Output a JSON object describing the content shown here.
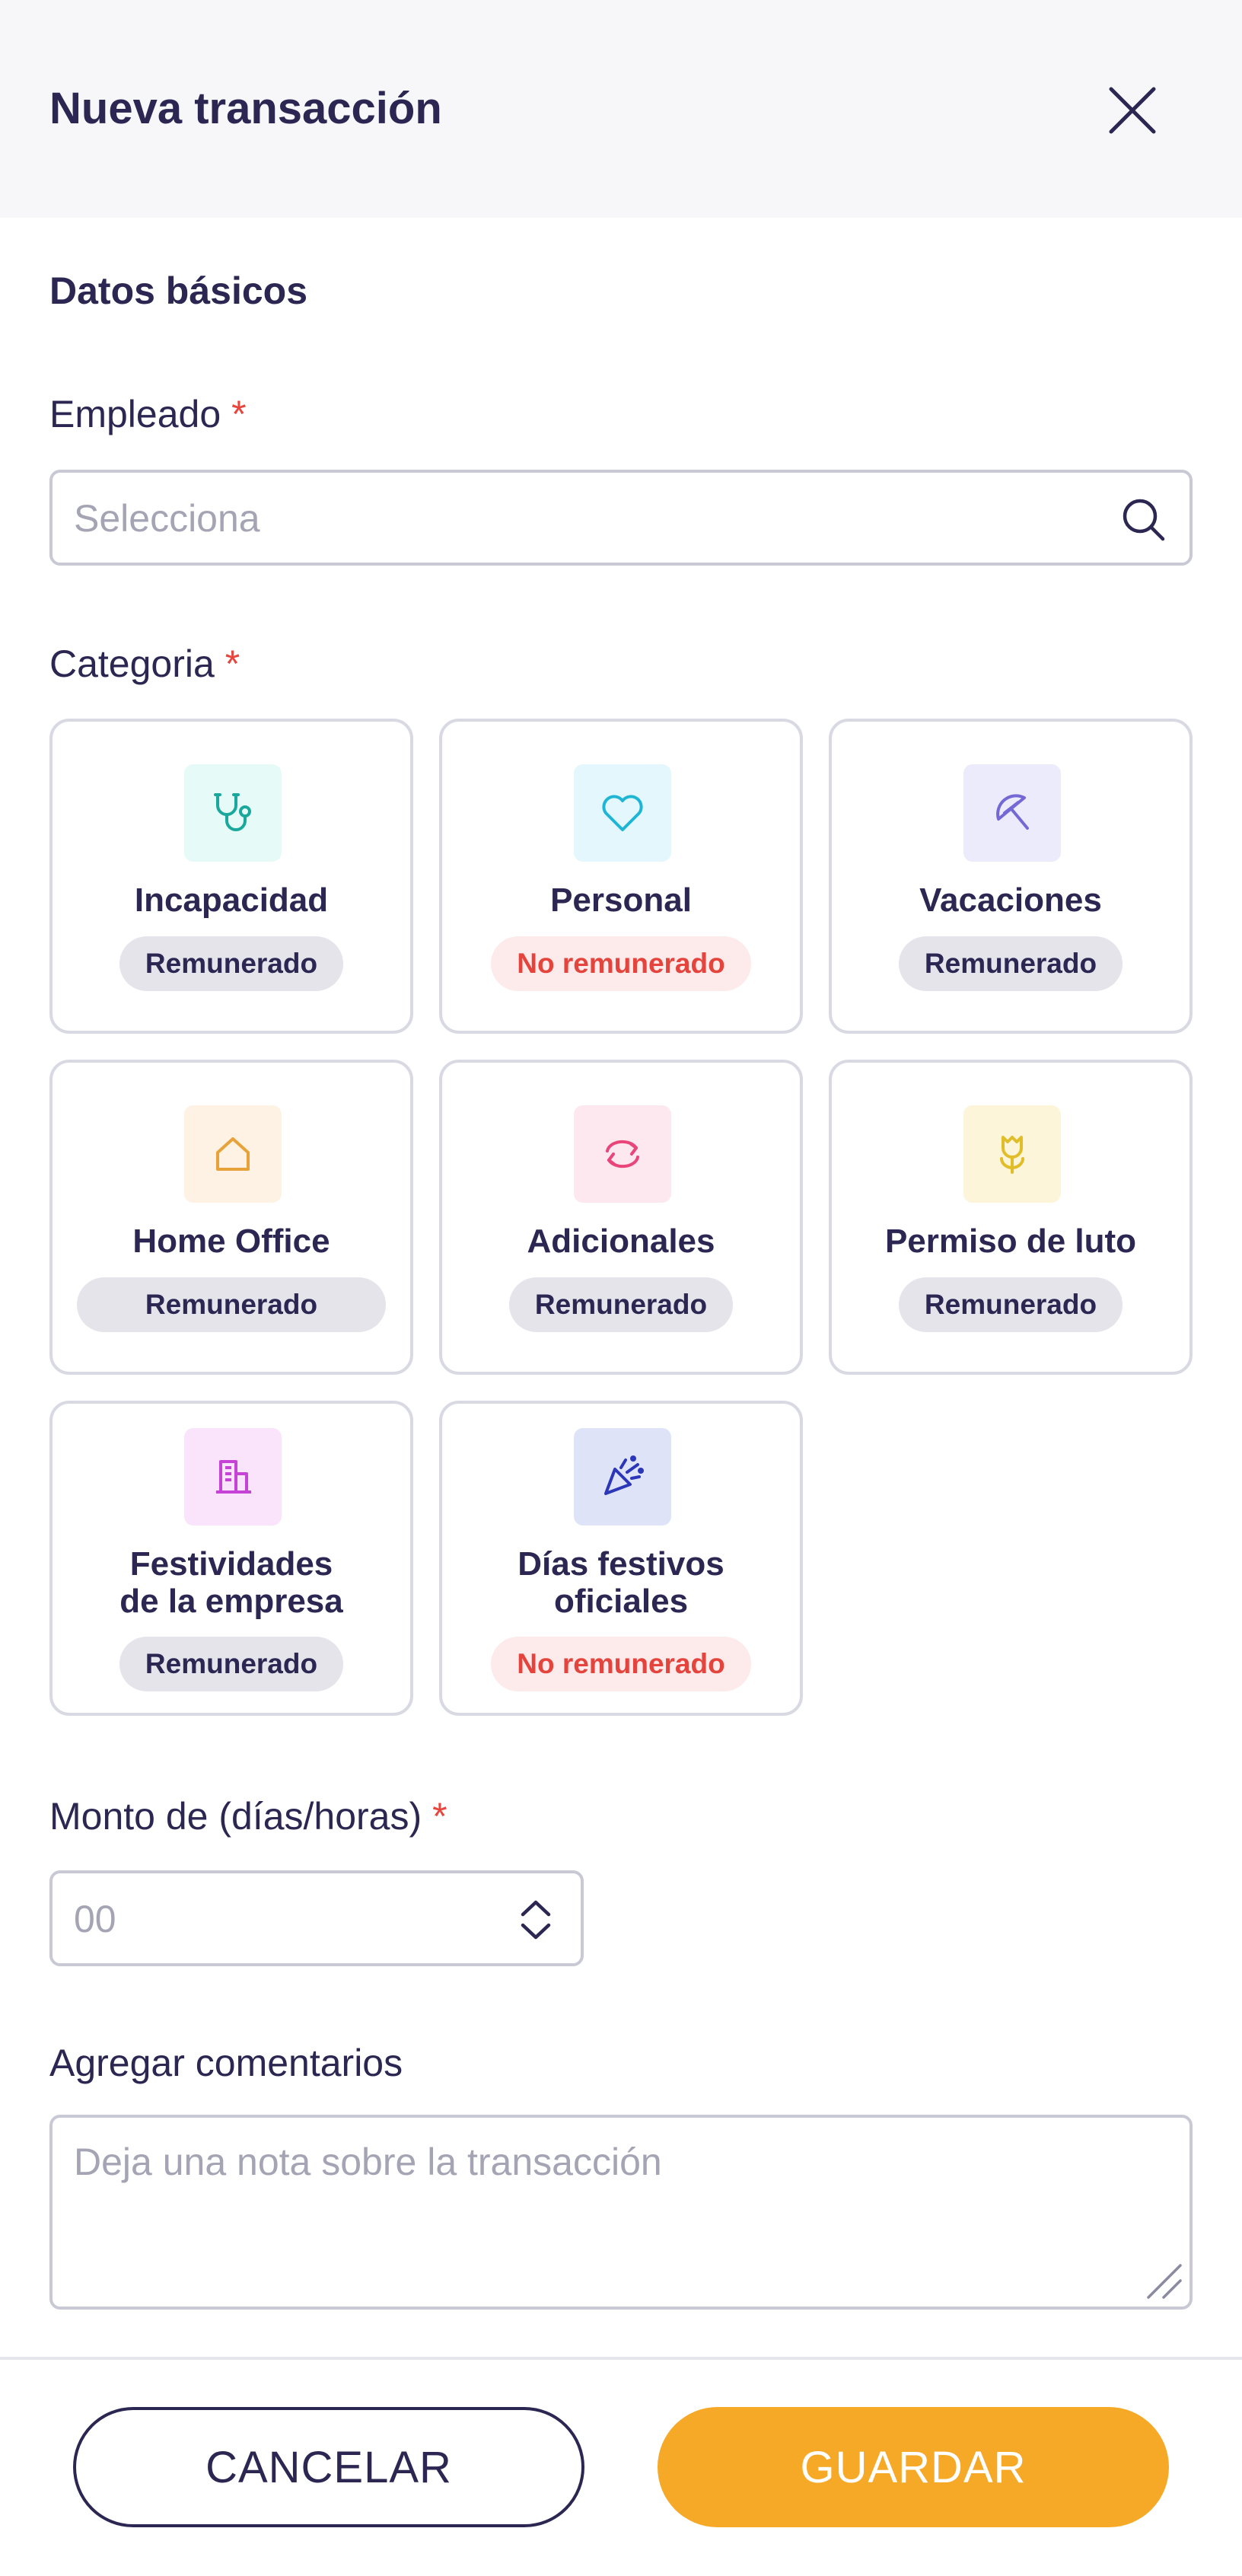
{
  "header": {
    "title": "Nueva transacción",
    "close_icon": "close-icon"
  },
  "section": {
    "title": "Datos básicos"
  },
  "employee": {
    "label": "Empleado",
    "required_mark": "*",
    "placeholder": "Selecciona",
    "value": "",
    "icon": "search-icon"
  },
  "category": {
    "label": "Categoria",
    "required_mark": "*",
    "items": [
      {
        "name": "Incapacidad",
        "badge": "Remunerado",
        "badge_type": "paid",
        "icon": "stethoscope-icon",
        "icon_color": "#1aa89c",
        "icon_bg": "#e6faf7"
      },
      {
        "name": "Personal",
        "badge": "No remunerado",
        "badge_type": "unpaid",
        "icon": "heart-icon",
        "icon_color": "#1fb6d6",
        "icon_bg": "#e4f7fc"
      },
      {
        "name": "Vacaciones",
        "badge": "Remunerado",
        "badge_type": "paid",
        "icon": "umbrella-icon",
        "icon_color": "#7468d6",
        "icon_bg": "#ecebfb"
      },
      {
        "name": "Home Office",
        "badge": "Remunerado",
        "badge_type": "paid",
        "icon": "home-icon",
        "icon_color": "#e8a23a",
        "icon_bg": "#fdf2e3"
      },
      {
        "name": "Adicionales",
        "badge": "Remunerado",
        "badge_type": "paid",
        "icon": "refresh-icon",
        "icon_color": "#e9457a",
        "icon_bg": "#fde8ef"
      },
      {
        "name": "Permiso de luto",
        "badge": "Remunerado",
        "badge_type": "paid",
        "icon": "tulip-icon",
        "icon_color": "#e2bd2a",
        "icon_bg": "#fdf5d9"
      },
      {
        "name": "Festividades de la empresa",
        "name_line1": "Festividades",
        "name_line2": "de la empresa",
        "badge": "Remunerado",
        "badge_type": "paid",
        "icon": "building-icon",
        "icon_color": "#c544d6",
        "icon_bg": "#f9e4fb"
      },
      {
        "name": "Días festivos oficiales",
        "name_line1": "Días festivos",
        "name_line2": "oficiales",
        "badge": "No remunerado",
        "badge_type": "unpaid",
        "icon": "party-popper-icon",
        "icon_color": "#2c36b8",
        "icon_bg": "#dfe3f8"
      }
    ]
  },
  "amount": {
    "label": "Monto de (días/horas)",
    "required_mark": "*",
    "placeholder": "00",
    "value": "",
    "icon": "chevron-up-down-icon"
  },
  "comments": {
    "label": "Agregar comentarios",
    "placeholder": "Deja una nota sobre la transacción",
    "value": ""
  },
  "actions": {
    "cancel_label": "CANCELAR",
    "save_label": "GUARDAR"
  },
  "colors": {
    "primary_text": "#2b2752",
    "accent": "#f6a827",
    "required": "#e8453c",
    "paid_badge_bg": "#e4e4ea",
    "unpaid_badge_bg": "#fdeaea",
    "unpaid_badge_text": "#e5443d"
  }
}
